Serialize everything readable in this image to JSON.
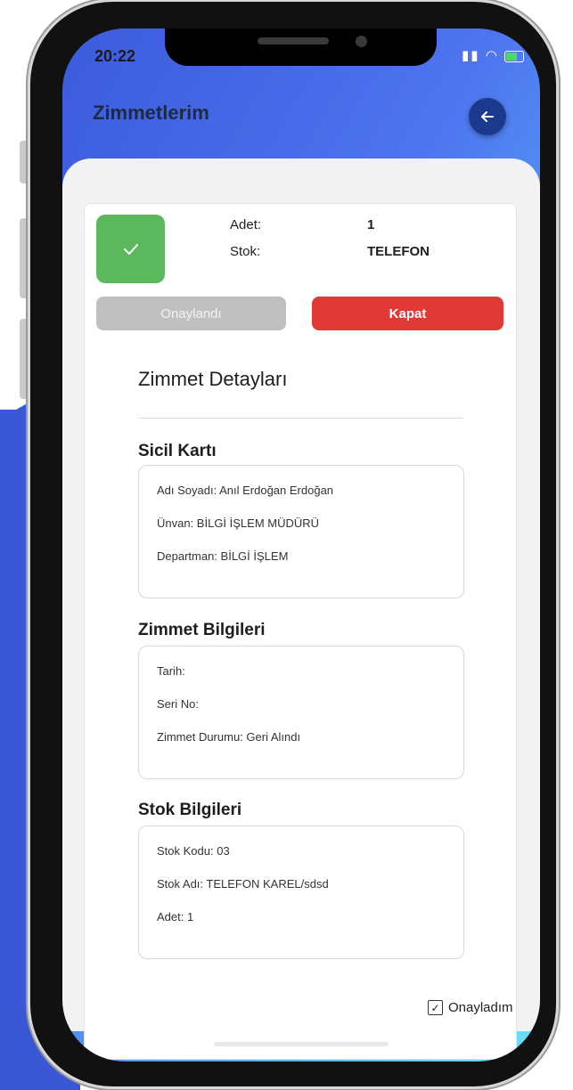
{
  "status_bar": {
    "time": "20:22"
  },
  "header": {
    "title": "Zimmetlerim",
    "back_icon": "arrow-left-icon"
  },
  "summary": {
    "status_icon": "checkmark-icon",
    "adet_label": "Adet:",
    "adet_value": "1",
    "stok_label": "Stok:",
    "stok_value": "TELEFON",
    "approved_label": "Onaylandı",
    "close_label": "Kapat"
  },
  "details": {
    "title": "Zimmet Detayları",
    "sicil": {
      "title": "Sicil Kartı",
      "lines": [
        "Adı Soyadı: Anıl Erdoğan Erdoğan",
        "Ünvan: BİLGİ İŞLEM MÜDÜRÜ",
        "Departman: BİLGİ İŞLEM"
      ]
    },
    "zimmet": {
      "title": "Zimmet Bilgileri",
      "lines": [
        "Tarih:",
        "Seri No:",
        "Zimmet Durumu: Geri Alındı"
      ]
    },
    "stok": {
      "title": "Stok Bilgileri",
      "lines": [
        "Stok Kodu: 03",
        "Stok Adı: TELEFON KAREL/sdsd",
        "Adet: 1"
      ]
    }
  },
  "confirm": {
    "label": "Onayladım",
    "checked": true
  },
  "colors": {
    "approved_green": "#5cb85c",
    "close_red": "#e03a36",
    "back_blue": "#1b3a8e"
  }
}
